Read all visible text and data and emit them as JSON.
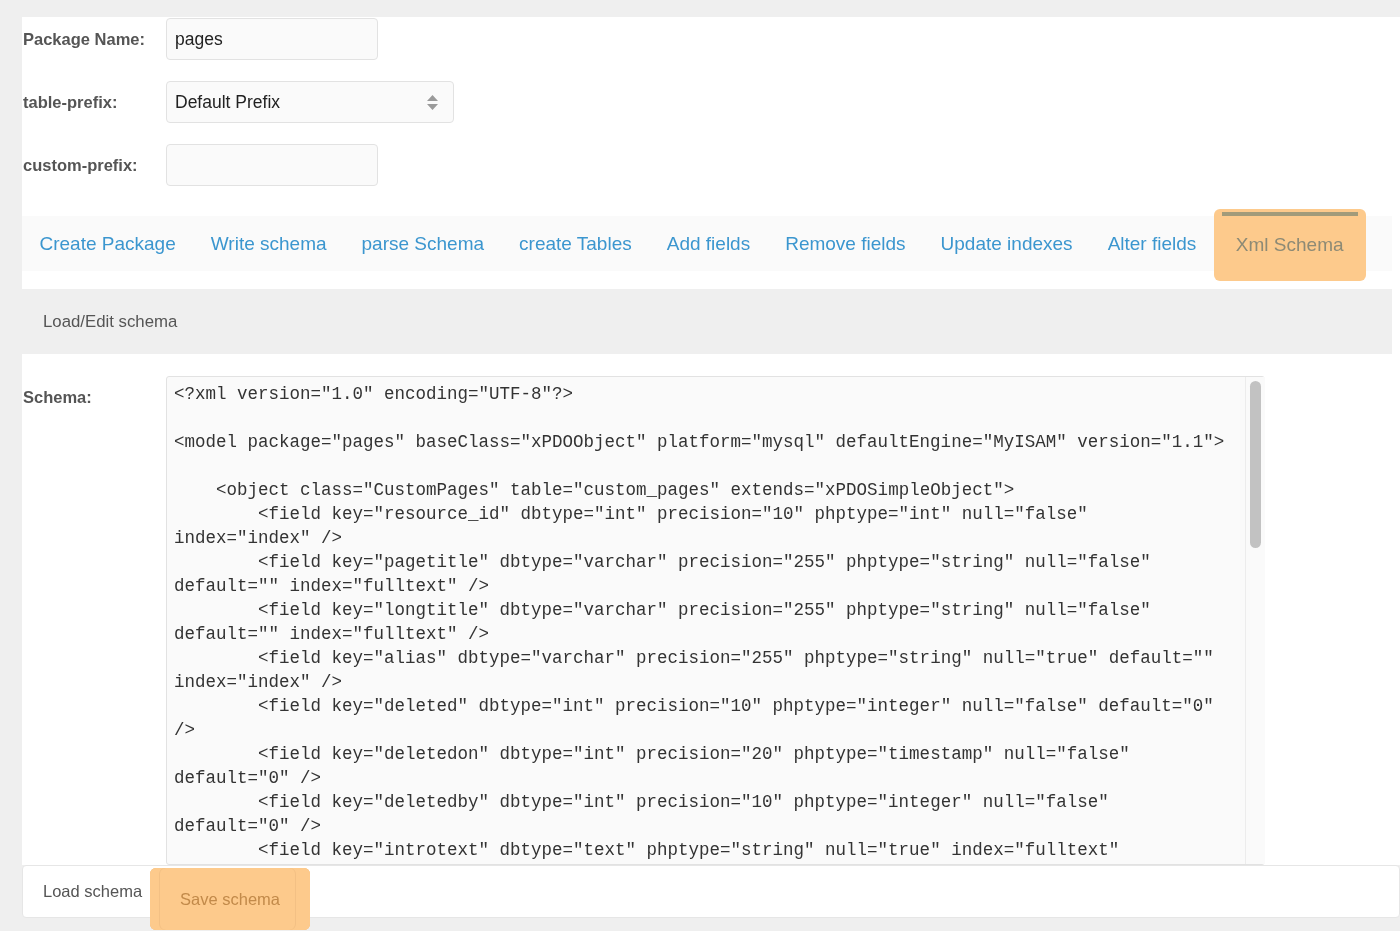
{
  "form": {
    "fields": [
      {
        "kind": "text",
        "label": "Package Name:",
        "value": "pages"
      },
      {
        "kind": "select",
        "label": "table-prefix:",
        "value": "Default Prefix"
      },
      {
        "kind": "text",
        "label": "custom-prefix:"
      }
    ]
  },
  "tabs": [
    {
      "label": "Create Package",
      "selected": false
    },
    {
      "label": "Write schema",
      "selected": false
    },
    {
      "label": "parse Schema",
      "selected": false
    },
    {
      "label": "create Tables",
      "selected": false
    },
    {
      "label": "Add fields",
      "selected": false
    },
    {
      "label": "Remove fields",
      "selected": false
    },
    {
      "label": "Update indexes",
      "selected": false
    },
    {
      "label": "Alter fields",
      "selected": false
    },
    {
      "label": "Xml Schema",
      "selected": true
    }
  ],
  "panel": {
    "title": "Load/Edit schema",
    "schema": {
      "label": "Schema:",
      "value": "<?xml version=\"1.0\" encoding=\"UTF-8\"?>\n\n<model package=\"pages\" baseClass=\"xPDOObject\" platform=\"mysql\" defaultEngine=\"MyISAM\" version=\"1.1\">\n\n    <object class=\"CustomPages\" table=\"custom_pages\" extends=\"xPDOSimpleObject\">\n        <field key=\"resource_id\" dbtype=\"int\" precision=\"10\" phptype=\"int\" null=\"false\" index=\"index\" />\n        <field key=\"pagetitle\" dbtype=\"varchar\" precision=\"255\" phptype=\"string\" null=\"false\" default=\"\" index=\"fulltext\" />\n        <field key=\"longtitle\" dbtype=\"varchar\" precision=\"255\" phptype=\"string\" null=\"false\" default=\"\" index=\"fulltext\" />\n        <field key=\"alias\" dbtype=\"varchar\" precision=\"255\" phptype=\"string\" null=\"true\" default=\"\" index=\"index\" />\n        <field key=\"deleted\" dbtype=\"int\" precision=\"10\" phptype=\"integer\" null=\"false\" default=\"0\" />\n        <field key=\"deletedon\" dbtype=\"int\" precision=\"20\" phptype=\"timestamp\" null=\"false\" default=\"0\" />\n        <field key=\"deletedby\" dbtype=\"int\" precision=\"10\" phptype=\"integer\" null=\"false\" default=\"0\" />\n        <field key=\"introtext\" dbtype=\"text\" phptype=\"string\" null=\"true\" index=\"fulltext\""
    }
  },
  "buttons": [
    {
      "label": "Load schema",
      "highlighted": false
    },
    {
      "label": "Save schema",
      "highlighted": true
    }
  ]
}
